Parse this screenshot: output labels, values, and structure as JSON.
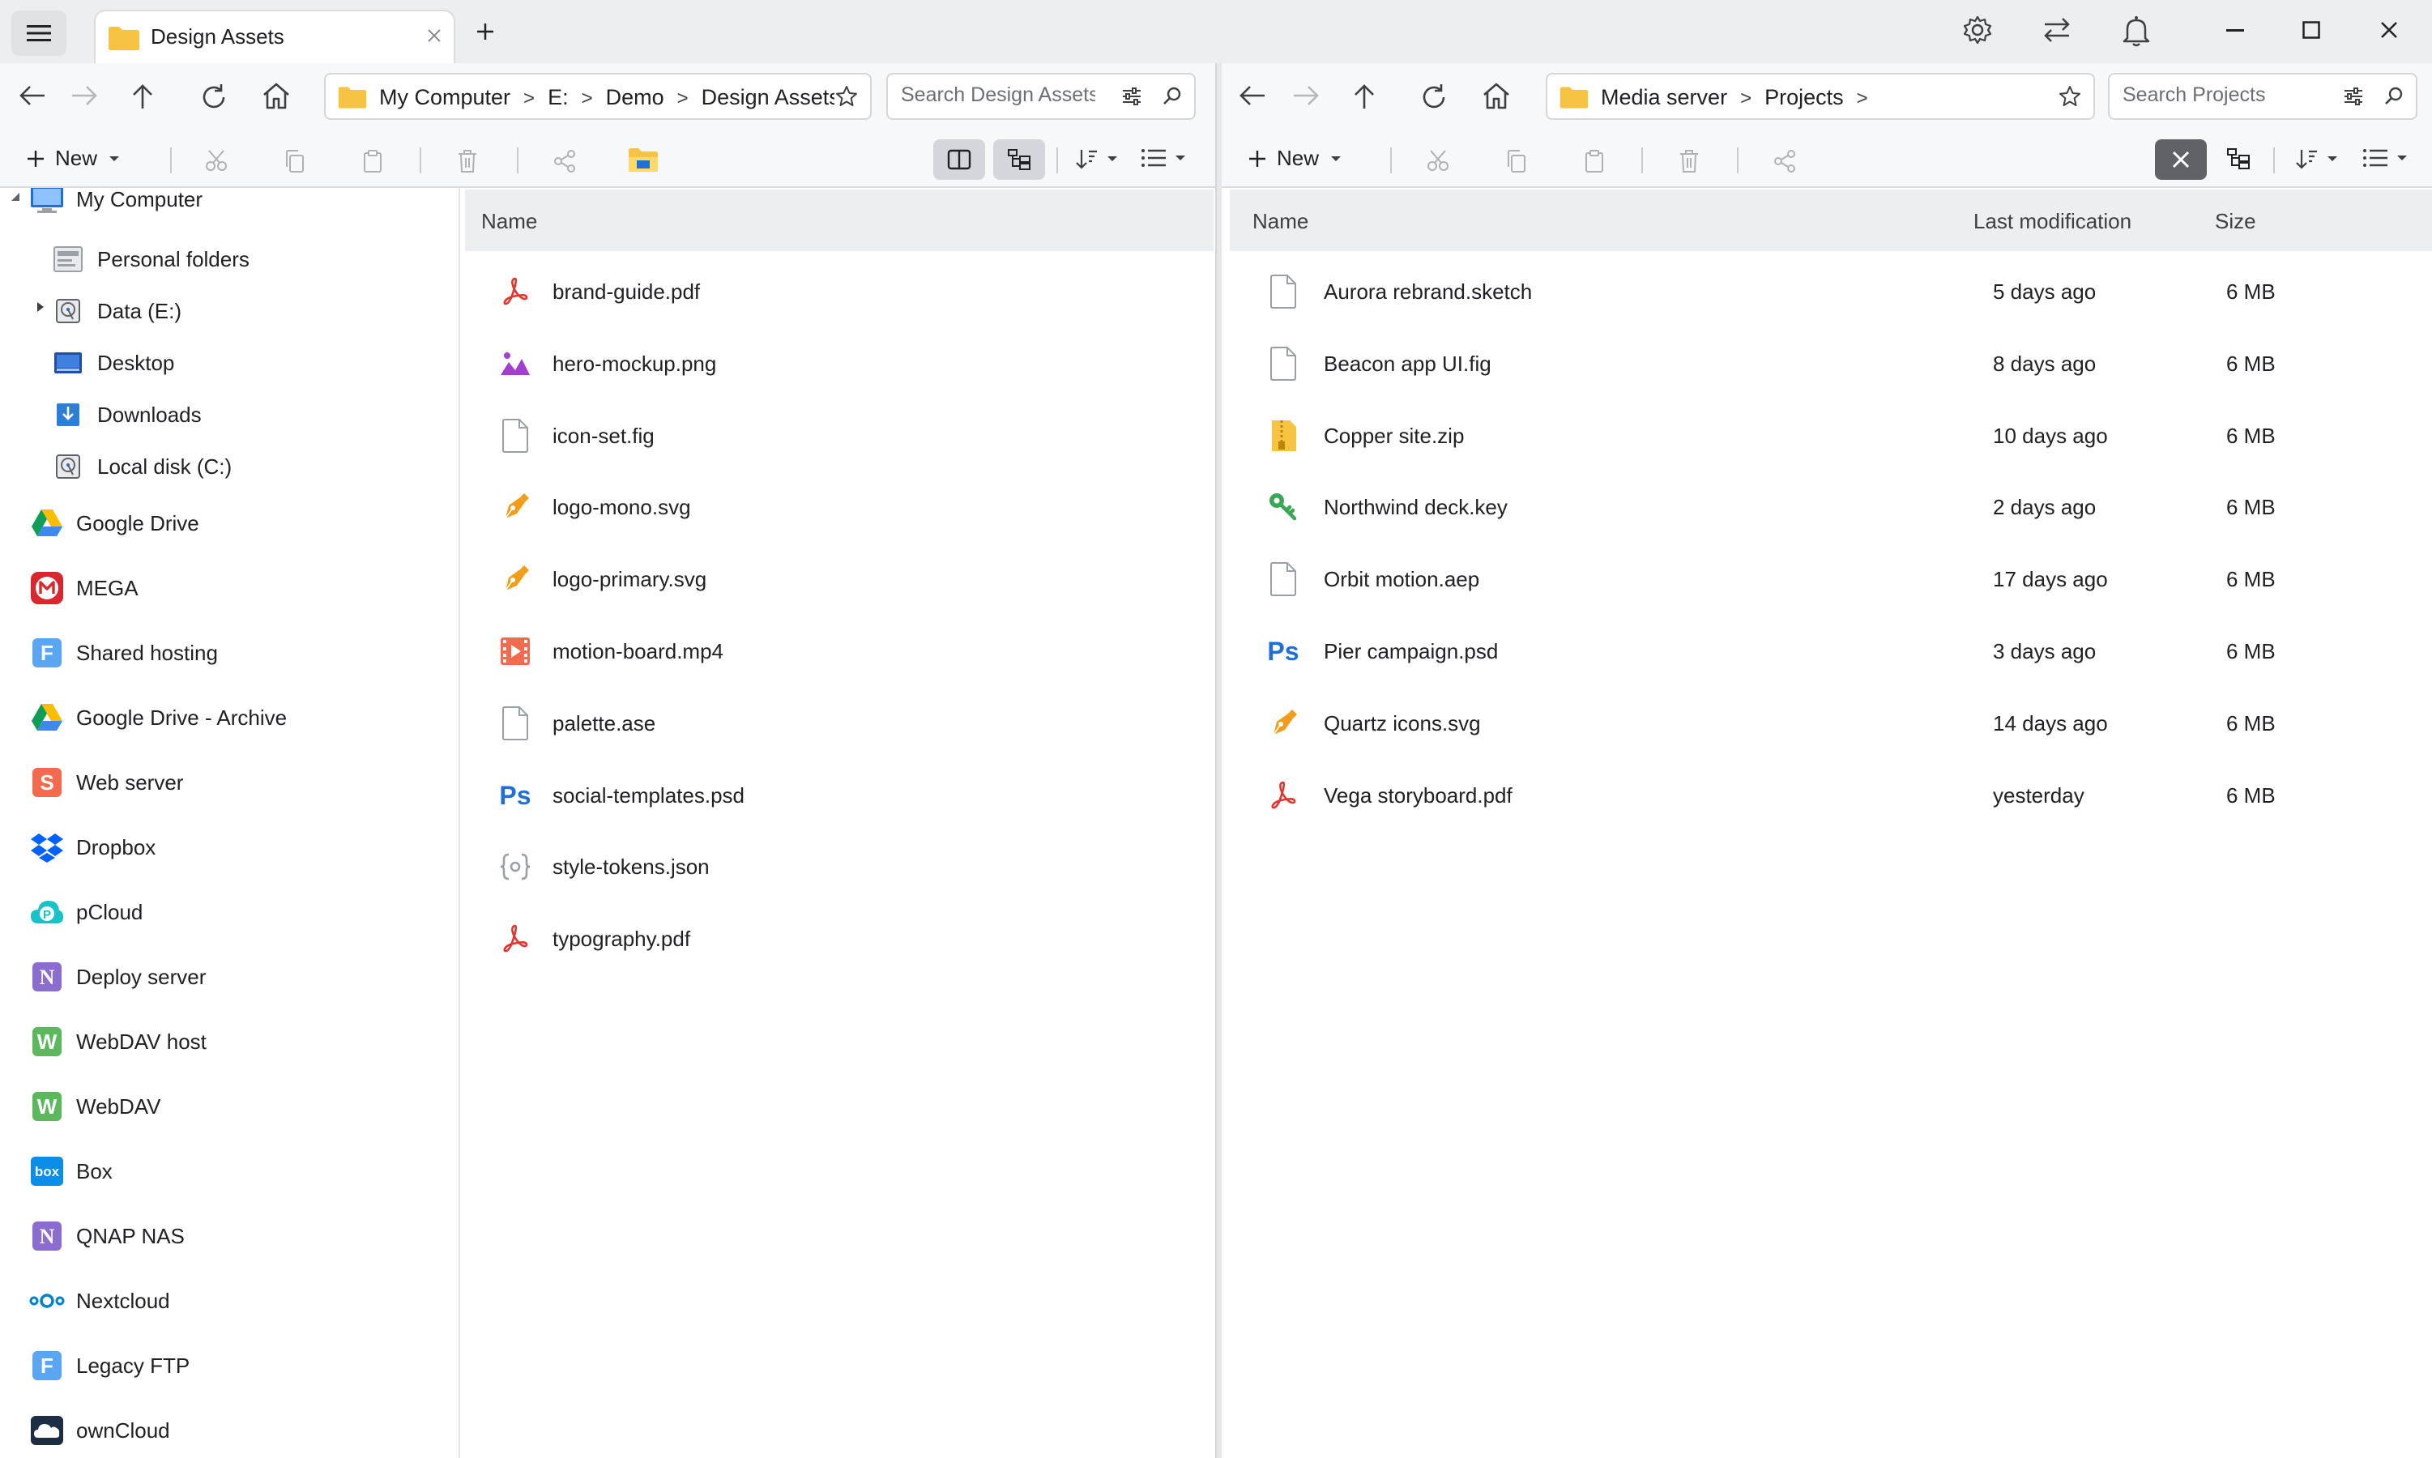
{
  "colors": {
    "accent_folder": "#f6c343",
    "pdf_red": "#e3342f",
    "photoshop_blue": "#1f6fd6",
    "vector_orange": "#f29d1a",
    "image_purple": "#a43ed0"
  },
  "titlebar": {
    "tab_title": "Design Assets",
    "icons": [
      "menu-icon",
      "settings-icon",
      "sync-icon",
      "bell-icon",
      "minimize-icon",
      "maximize-icon",
      "close-icon"
    ]
  },
  "left": {
    "breadcrumb": [
      "My Computer",
      "E:",
      "Demo",
      "Design Assets"
    ],
    "search_placeholder": "Search Design Assets",
    "new_label": "New",
    "column_name": "Name",
    "files": [
      {
        "name": "brand-guide.pdf",
        "icon": "pdf-icon"
      },
      {
        "name": "hero-mockup.png",
        "icon": "image-icon"
      },
      {
        "name": "icon-set.fig",
        "icon": "file-icon"
      },
      {
        "name": "logo-mono.svg",
        "icon": "vector-icon"
      },
      {
        "name": "logo-primary.svg",
        "icon": "vector-icon"
      },
      {
        "name": "motion-board.mp4",
        "icon": "video-icon"
      },
      {
        "name": "palette.ase",
        "icon": "file-icon"
      },
      {
        "name": "social-templates.psd",
        "icon": "photoshop-icon"
      },
      {
        "name": "style-tokens.json",
        "icon": "json-icon"
      },
      {
        "name": "typography.pdf",
        "icon": "pdf-icon"
      }
    ]
  },
  "sidebar": {
    "root": "My Computer",
    "computer_items": [
      {
        "label": "Personal folders",
        "icon": "personal-folders-icon"
      },
      {
        "label": "Data (E:)",
        "icon": "drive-icon"
      },
      {
        "label": "Desktop",
        "icon": "desktop-icon"
      },
      {
        "label": "Downloads",
        "icon": "downloads-icon"
      },
      {
        "label": "Local disk (C:)",
        "icon": "drive-icon"
      }
    ],
    "services": [
      {
        "label": "Google Drive",
        "icon": "google-drive-icon"
      },
      {
        "label": "MEGA",
        "icon": "mega-icon"
      },
      {
        "label": "Shared hosting",
        "icon": "ftp-icon"
      },
      {
        "label": "Google Drive - Archive",
        "icon": "google-drive-icon"
      },
      {
        "label": "Web server",
        "icon": "sftp-icon"
      },
      {
        "label": "Dropbox",
        "icon": "dropbox-icon"
      },
      {
        "label": "pCloud",
        "icon": "pcloud-icon"
      },
      {
        "label": "Deploy server",
        "icon": "nas-icon"
      },
      {
        "label": "WebDAV host",
        "icon": "webdav-icon"
      },
      {
        "label": "WebDAV",
        "icon": "webdav-icon"
      },
      {
        "label": "Box",
        "icon": "box-icon"
      },
      {
        "label": "QNAP NAS",
        "icon": "nas-icon"
      },
      {
        "label": "Nextcloud",
        "icon": "nextcloud-icon"
      },
      {
        "label": "Legacy FTP",
        "icon": "ftp-icon"
      },
      {
        "label": "ownCloud",
        "icon": "owncloud-icon"
      }
    ]
  },
  "right": {
    "breadcrumb": [
      "Media server",
      "Projects"
    ],
    "search_placeholder": "Search Projects",
    "new_label": "New",
    "columns": {
      "name": "Name",
      "modified": "Last modification",
      "size": "Size"
    },
    "files": [
      {
        "name": "Aurora rebrand.sketch",
        "modified": "5 days ago",
        "size": "6 MB",
        "icon": "file-icon"
      },
      {
        "name": "Beacon app UI.fig",
        "modified": "8 days ago",
        "size": "6 MB",
        "icon": "file-icon"
      },
      {
        "name": "Copper site.zip",
        "modified": "10 days ago",
        "size": "6 MB",
        "icon": "zip-icon"
      },
      {
        "name": "Northwind deck.key",
        "modified": "2 days ago",
        "size": "6 MB",
        "icon": "keynote-icon"
      },
      {
        "name": "Orbit motion.aep",
        "modified": "17 days ago",
        "size": "6 MB",
        "icon": "file-icon"
      },
      {
        "name": "Pier campaign.psd",
        "modified": "3 days ago",
        "size": "6 MB",
        "icon": "photoshop-icon"
      },
      {
        "name": "Quartz icons.svg",
        "modified": "14 days ago",
        "size": "6 MB",
        "icon": "vector-icon"
      },
      {
        "name": "Vega storyboard.pdf",
        "modified": "yesterday",
        "size": "6 MB",
        "icon": "pdf-icon"
      }
    ]
  },
  "service_letters": {
    "ftp": "F",
    "sftp": "S",
    "nas": "N",
    "webdav": "W",
    "box": "box",
    "pcloud": "P",
    "mega": "M",
    "photoshop": "Ps"
  }
}
